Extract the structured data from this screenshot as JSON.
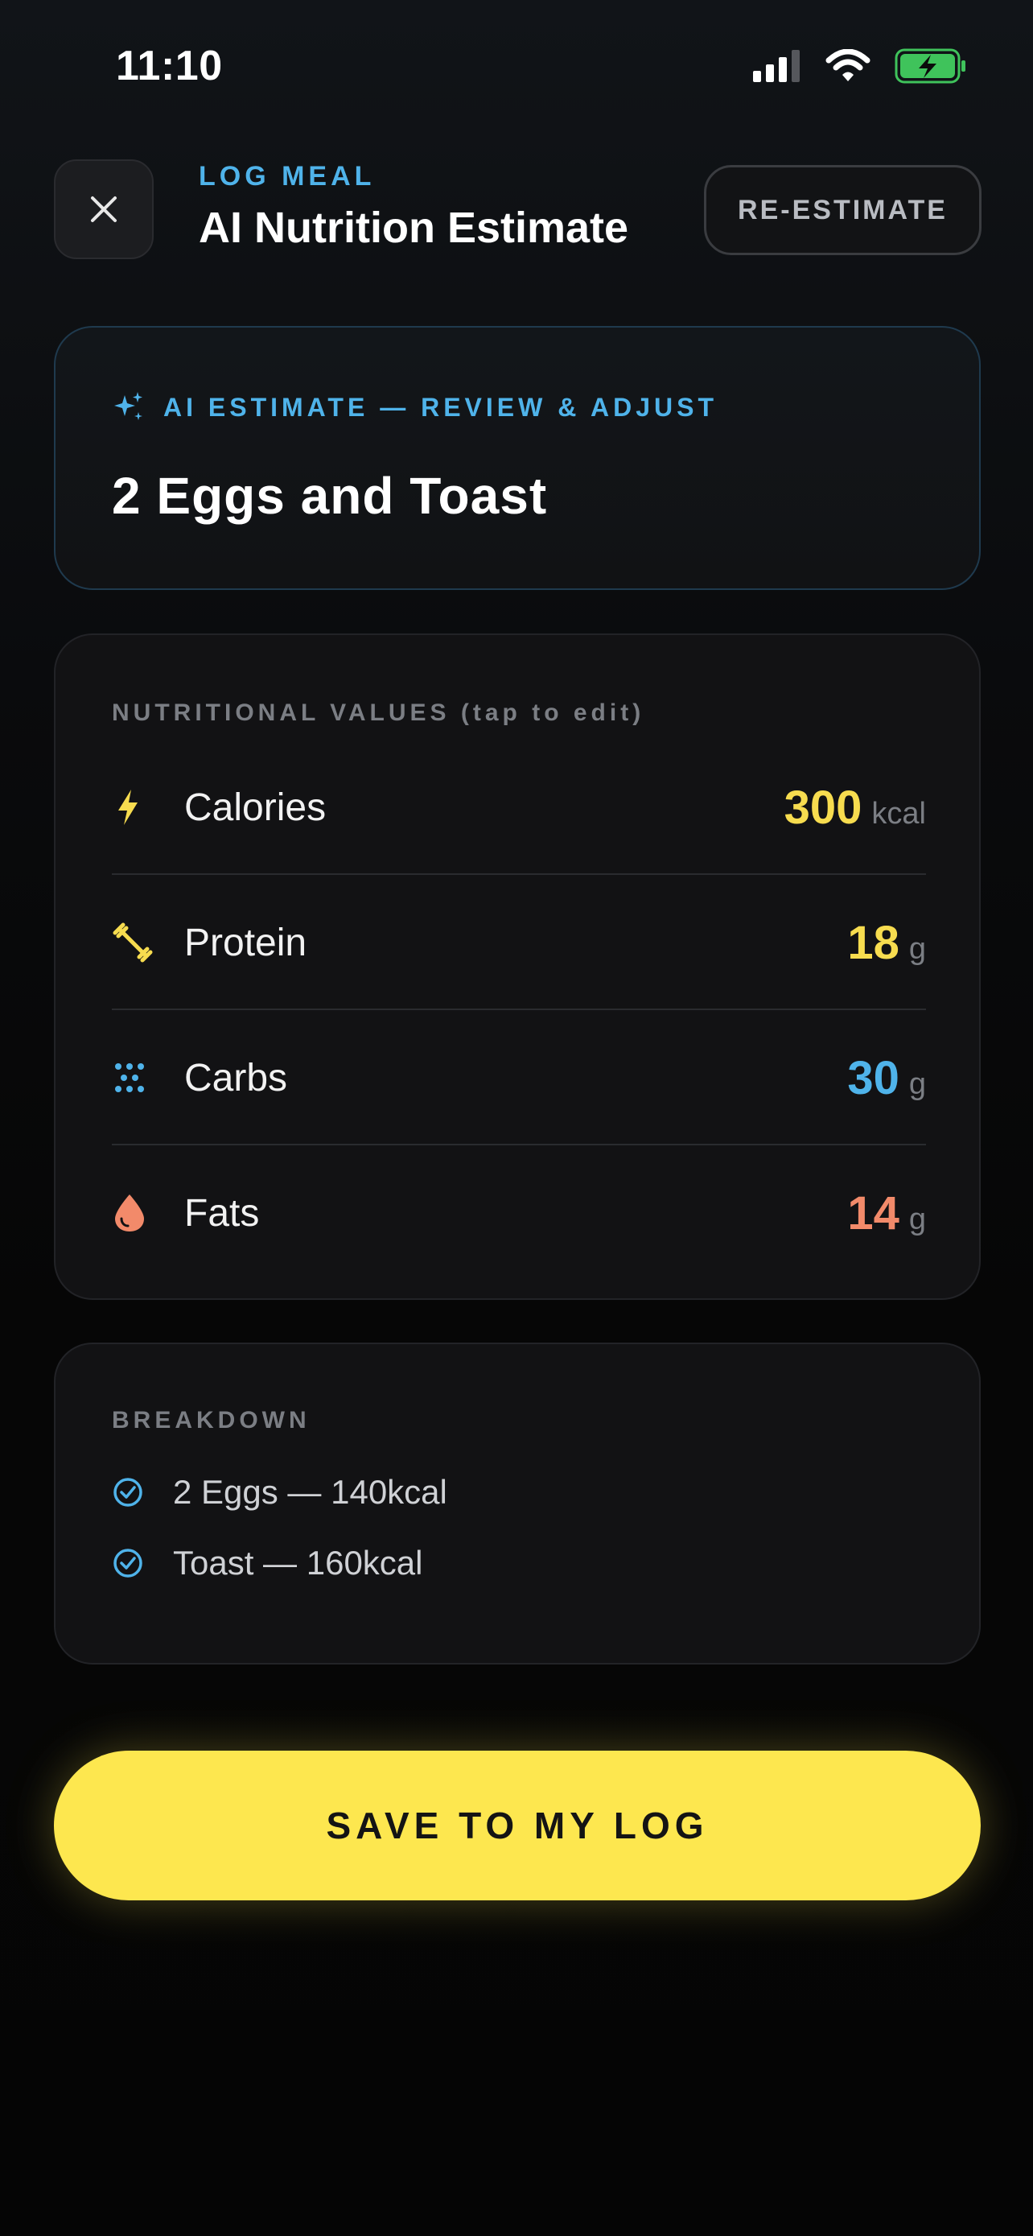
{
  "status_bar": {
    "time": "11:10",
    "icons": [
      "signal-icon",
      "wifi-icon",
      "battery-charging-icon"
    ]
  },
  "header": {
    "close_icon": "close-icon",
    "kicker": "LOG MEAL",
    "title": "AI Nutrition Estimate",
    "reestimate_label": "RE-ESTIMATE"
  },
  "ai_card": {
    "kicker": "AI ESTIMATE — REVIEW & ADJUST",
    "icon": "sparkles-icon",
    "meal_name": "2 Eggs and Toast"
  },
  "nutrition": {
    "label": "NUTRITIONAL VALUES (tap to edit)",
    "rows": [
      {
        "name": "Calories",
        "value": "300",
        "unit": "kcal",
        "icon": "bolt-icon",
        "color": "#f7dc4f"
      },
      {
        "name": "Protein",
        "value": "18",
        "unit": "g",
        "icon": "dumbbell-icon",
        "color": "#f7dc4f"
      },
      {
        "name": "Carbs",
        "value": "30",
        "unit": "g",
        "icon": "grain-icon",
        "color": "#4fb3ea"
      },
      {
        "name": "Fats",
        "value": "14",
        "unit": "g",
        "icon": "drop-icon",
        "color": "#f28a6a"
      }
    ]
  },
  "breakdown": {
    "label": "BREAKDOWN",
    "items": [
      {
        "text": "2 Eggs — 140kcal",
        "icon": "check-circle-icon"
      },
      {
        "text": "Toast — 160kcal",
        "icon": "check-circle-icon"
      }
    ]
  },
  "save_button": {
    "label": "SAVE TO MY LOG"
  },
  "colors": {
    "accent_blue": "#4fb3ea",
    "accent_yellow": "#fde74f",
    "fat_orange": "#f28a6a",
    "background": "#050505"
  }
}
